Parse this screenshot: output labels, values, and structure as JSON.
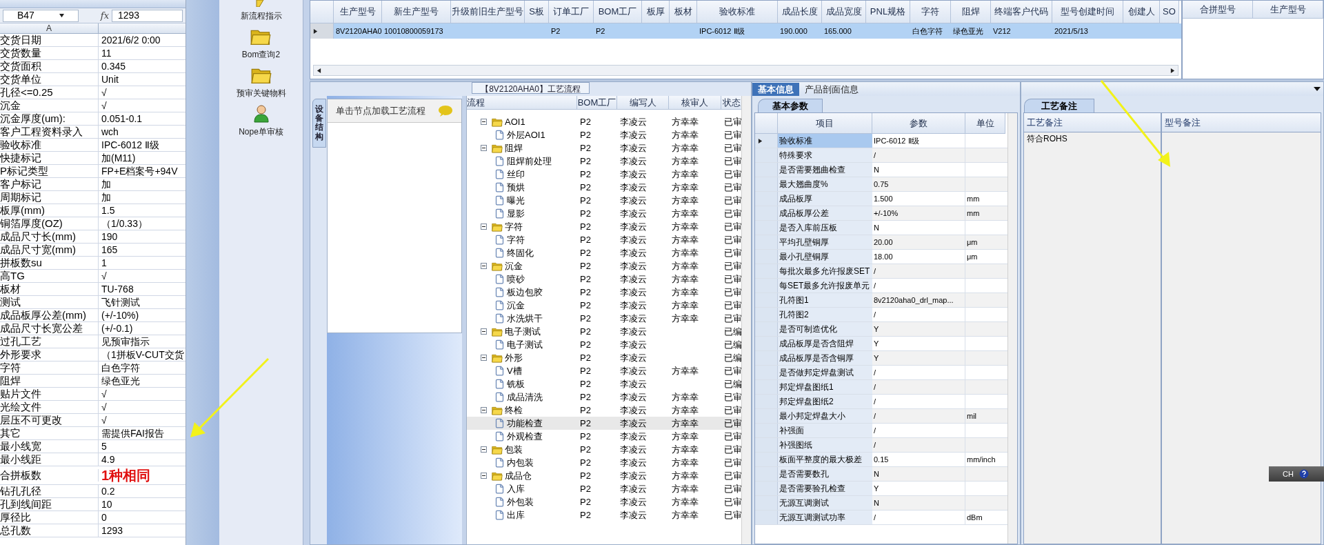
{
  "spreadsheet": {
    "name_box": "B47",
    "formula_label": "fx",
    "formula": "1293",
    "column_header": "A",
    "rows": [
      {
        "label": "交货日期",
        "value": "2021/6/2 0:00",
        "kind": "text"
      },
      {
        "label": "交货数量",
        "value": "11",
        "kind": "text"
      },
      {
        "label": "交货面积",
        "value": "0.345",
        "kind": "text"
      },
      {
        "label": "交货单位",
        "value": "Unit",
        "kind": "text"
      },
      {
        "label": "孔径<=0.25",
        "value": "√",
        "kind": "text"
      },
      {
        "label": "沉金",
        "value": "√",
        "kind": "text"
      },
      {
        "label": "沉金厚度(um):",
        "value": "0.051-0.1",
        "kind": "text"
      },
      {
        "label": "客户工程资料录入",
        "value": "wch",
        "kind": "text"
      },
      {
        "label": "验收标准",
        "value": "IPC-6012 Ⅱ级",
        "kind": "text"
      },
      {
        "label": "快捷标记",
        "value": "加(M11)",
        "kind": "text"
      },
      {
        "label": "P标记类型",
        "value": "FP+E档案号+94V",
        "kind": "text"
      },
      {
        "label": "客户标记",
        "value": "加",
        "kind": "text"
      },
      {
        "label": "周期标记",
        "value": "加",
        "kind": "text"
      },
      {
        "label": "板厚(mm)",
        "value": "1.5",
        "kind": "text"
      },
      {
        "label": "铜箔厚度(OZ)",
        "value": "（1/0.33）",
        "kind": "text"
      },
      {
        "label": "成品尺寸长(mm)",
        "value": "190",
        "kind": "text"
      },
      {
        "label": "成品尺寸宽(mm)",
        "value": "165",
        "kind": "text"
      },
      {
        "label": "拼板数su",
        "value": "1",
        "kind": "text"
      },
      {
        "label": "高TG",
        "value": "√",
        "kind": "text"
      },
      {
        "label": "板材",
        "value": "TU-768",
        "kind": "text"
      },
      {
        "label": "测试",
        "value": "飞针测试",
        "kind": "text"
      },
      {
        "label": "成品板厚公差(mm)",
        "value": "(+/-10%)",
        "kind": "text"
      },
      {
        "label": "成品尺寸长宽公差",
        "value": "(+/-0.1)",
        "kind": "text"
      },
      {
        "label": "过孔工艺",
        "value": "见预审指示",
        "kind": "text"
      },
      {
        "label": "外形要求",
        "value": "（1拼板V-CUT交货",
        "kind": "text"
      },
      {
        "label": "字符",
        "value": "白色字符",
        "kind": "text"
      },
      {
        "label": "阻焊",
        "value": "绿色亚光",
        "kind": "text"
      },
      {
        "label": "贴片文件",
        "value": "√",
        "kind": "text"
      },
      {
        "label": "光绘文件",
        "value": "√",
        "kind": "text"
      },
      {
        "label": "层压不可更改",
        "value": "√",
        "kind": "text"
      },
      {
        "label": "其它",
        "value": "需提供FAI报告",
        "kind": "text"
      },
      {
        "label": "最小线宽",
        "value": "5",
        "kind": "text"
      },
      {
        "label": "最小线距",
        "value": "4.9",
        "kind": "text"
      },
      {
        "label": "合拼板数",
        "value": "1种相同",
        "kind": "emphasis"
      },
      {
        "label": "钻孔孔径",
        "value": "0.2",
        "kind": "text"
      },
      {
        "label": "孔到线间距",
        "value": "10",
        "kind": "text"
      },
      {
        "label": "厚径比",
        "value": "0",
        "kind": "text"
      },
      {
        "label": "总孔数",
        "value": "1293",
        "kind": "text"
      }
    ]
  },
  "sidebar": {
    "items": [
      {
        "label": "新流程指示",
        "kind": "pencil"
      },
      {
        "label": "Bom查询2",
        "kind": "folder"
      },
      {
        "label": "预审关键物料",
        "kind": "folder"
      },
      {
        "label": "Nope单审核",
        "kind": "person"
      }
    ]
  },
  "product_grid": {
    "columns": [
      "生产型号",
      "新生产型号",
      "升级前旧生产型号",
      "S板",
      "订单工厂",
      "BOM工厂",
      "板厚",
      "板材",
      "验收标准",
      "成品长度",
      "成品宽度",
      "PNL规格",
      "字符",
      "阻焊",
      "终端客户代码",
      "型号创建时间",
      "创建人",
      "SO"
    ],
    "rows": [
      {
        "selected": true,
        "cells": [
          "8V2120AHA0",
          "10010800059173",
          "",
          "",
          "P2",
          "P2",
          "",
          "",
          "IPC-6012 Ⅱ级",
          "190.000",
          "165.000",
          "",
          "白色字符",
          "绿色亚光",
          "V212",
          "2021/5/13",
          "",
          ""
        ]
      }
    ]
  },
  "merge_grid": {
    "columns": [
      "合拼型号",
      "生产型号"
    ]
  },
  "process_panel": {
    "title": "【8V2120AHA0】工艺流程",
    "side_tab": "设备结构",
    "hint": "单击节点加载工艺流程",
    "columns": [
      "流程",
      "BOM工厂",
      "编写人",
      "核审人",
      "状态"
    ],
    "rows": [
      {
        "name": "AOI1",
        "bom": "P2",
        "writer": "李凌云",
        "reviewer": "方幸幸",
        "status": "已审",
        "expanded": true,
        "selected": false,
        "children": [
          {
            "name": "外层AOI1",
            "bom": "P2",
            "writer": "李凌云",
            "reviewer": "方幸幸",
            "status": "已审",
            "selected": false
          }
        ]
      },
      {
        "name": "阻焊",
        "bom": "P2",
        "writer": "李凌云",
        "reviewer": "方幸幸",
        "status": "已审",
        "expanded": true,
        "selected": false,
        "children": [
          {
            "name": "阻焊前处理",
            "bom": "P2",
            "writer": "李凌云",
            "reviewer": "方幸幸",
            "status": "已审",
            "selected": false
          },
          {
            "name": "丝印",
            "bom": "P2",
            "writer": "李凌云",
            "reviewer": "方幸幸",
            "status": "已审",
            "selected": false
          },
          {
            "name": "预烘",
            "bom": "P2",
            "writer": "李凌云",
            "reviewer": "方幸幸",
            "status": "已审",
            "selected": false
          },
          {
            "name": "曝光",
            "bom": "P2",
            "writer": "李凌云",
            "reviewer": "方幸幸",
            "status": "已审",
            "selected": false
          },
          {
            "name": "显影",
            "bom": "P2",
            "writer": "李凌云",
            "reviewer": "方幸幸",
            "status": "已审",
            "selected": false
          }
        ]
      },
      {
        "name": "字符",
        "bom": "P2",
        "writer": "李凌云",
        "reviewer": "方幸幸",
        "status": "已审",
        "expanded": true,
        "selected": false,
        "children": [
          {
            "name": "字符",
            "bom": "P2",
            "writer": "李凌云",
            "reviewer": "方幸幸",
            "status": "已审",
            "selected": false
          },
          {
            "name": "终固化",
            "bom": "P2",
            "writer": "李凌云",
            "reviewer": "方幸幸",
            "status": "已审",
            "selected": false
          }
        ]
      },
      {
        "name": "沉金",
        "bom": "P2",
        "writer": "李凌云",
        "reviewer": "方幸幸",
        "status": "已审",
        "expanded": true,
        "selected": false,
        "children": [
          {
            "name": "喷砂",
            "bom": "P2",
            "writer": "李凌云",
            "reviewer": "方幸幸",
            "status": "已审",
            "selected": false
          },
          {
            "name": "板边包胶",
            "bom": "P2",
            "writer": "李凌云",
            "reviewer": "方幸幸",
            "status": "已审",
            "selected": false
          },
          {
            "name": "沉金",
            "bom": "P2",
            "writer": "李凌云",
            "reviewer": "方幸幸",
            "status": "已审",
            "selected": false
          },
          {
            "name": "水洗烘干",
            "bom": "P2",
            "writer": "李凌云",
            "reviewer": "方幸幸",
            "status": "已审",
            "selected": false
          }
        ]
      },
      {
        "name": "电子测试",
        "bom": "P2",
        "writer": "李凌云",
        "status": "已编",
        "expanded": true,
        "selected": false,
        "children": [
          {
            "name": "电子测试",
            "bom": "P2",
            "writer": "李凌云",
            "status": "已编",
            "selected": false
          }
        ]
      },
      {
        "name": "外形",
        "bom": "P2",
        "writer": "李凌云",
        "status": "已编",
        "expanded": true,
        "selected": false,
        "children": [
          {
            "name": "V槽",
            "bom": "P2",
            "writer": "李凌云",
            "reviewer": "方幸幸",
            "status": "已审",
            "selected": false
          },
          {
            "name": "铣板",
            "bom": "P2",
            "writer": "李凌云",
            "status": "已编",
            "selected": false
          },
          {
            "name": "成品清洗",
            "bom": "P2",
            "writer": "李凌云",
            "reviewer": "方幸幸",
            "status": "已审",
            "selected": false
          }
        ]
      },
      {
        "name": "终检",
        "bom": "P2",
        "writer": "李凌云",
        "reviewer": "方幸幸",
        "status": "已审",
        "expanded": true,
        "selected": false,
        "children": [
          {
            "name": "功能检查",
            "bom": "P2",
            "writer": "李凌云",
            "reviewer": "方幸幸",
            "status": "已审",
            "selected": true
          },
          {
            "name": "外观检查",
            "bom": "P2",
            "writer": "李凌云",
            "reviewer": "方幸幸",
            "status": "已审",
            "selected": false
          }
        ]
      },
      {
        "name": "包装",
        "bom": "P2",
        "writer": "李凌云",
        "reviewer": "方幸幸",
        "status": "已审",
        "expanded": true,
        "selected": false,
        "children": [
          {
            "name": "内包装",
            "bom": "P2",
            "writer": "李凌云",
            "reviewer": "方幸幸",
            "status": "已审",
            "selected": false
          }
        ]
      },
      {
        "name": "成品仓",
        "bom": "P2",
        "writer": "李凌云",
        "reviewer": "方幸幸",
        "status": "已审",
        "expanded": true,
        "selected": false,
        "children": [
          {
            "name": "入库",
            "bom": "P2",
            "writer": "李凌云",
            "reviewer": "方幸幸",
            "status": "已审",
            "selected": false
          },
          {
            "name": "外包装",
            "bom": "P2",
            "writer": "李凌云",
            "reviewer": "方幸幸",
            "status": "已审",
            "selected": false
          },
          {
            "name": "出库",
            "bom": "P2",
            "writer": "李凌云",
            "reviewer": "方幸幸",
            "status": "已审",
            "selected": false
          }
        ]
      }
    ]
  },
  "info_panel": {
    "tabs": [
      {
        "label": "基本信息",
        "selected": true
      },
      {
        "label": "产品剖面信息",
        "selected": false
      }
    ],
    "subtab": "基本参数",
    "columns": [
      "项目",
      "参数",
      "单位"
    ],
    "rows": [
      {
        "item": "验收标准",
        "value": "IPC-6012 Ⅱ级",
        "unit": "",
        "selected": true
      },
      {
        "item": "特殊要求",
        "value": "/",
        "unit": "",
        "selected": false
      },
      {
        "item": "是否需要翘曲检查",
        "value": "N",
        "unit": "",
        "selected": false
      },
      {
        "item": "最大翘曲度%",
        "value": "0.75",
        "unit": "",
        "selected": false
      },
      {
        "item": "成品板厚",
        "value": "1.500",
        "unit": "mm",
        "selected": false
      },
      {
        "item": "成品板厚公差",
        "value": "+/-10%",
        "unit": "mm",
        "selected": false
      },
      {
        "item": "是否入库前压板",
        "value": "N",
        "unit": "",
        "selected": false
      },
      {
        "item": "平均孔壁铜厚",
        "value": "20.00",
        "unit": "μm",
        "selected": false
      },
      {
        "item": "最小孔壁铜厚",
        "value": "18.00",
        "unit": "μm",
        "selected": false
      },
      {
        "item": "每批次最多允许报废SET",
        "value": "/",
        "unit": "",
        "selected": false
      },
      {
        "item": "每SET最多允许报废单元",
        "value": "/",
        "unit": "",
        "selected": false
      },
      {
        "item": "孔符图1",
        "value": "8v2120aha0_drl_map...",
        "unit": "",
        "selected": false
      },
      {
        "item": "孔符图2",
        "value": "/",
        "unit": "",
        "selected": false
      },
      {
        "item": "是否可制造优化",
        "value": "Y",
        "unit": "",
        "selected": false
      },
      {
        "item": "成品板厚是否含阻焊",
        "value": "Y",
        "unit": "",
        "selected": false
      },
      {
        "item": "成品板厚是否含铜厚",
        "value": "Y",
        "unit": "",
        "selected": false
      },
      {
        "item": "是否做邦定焊盘测试",
        "value": "/",
        "unit": "",
        "selected": false
      },
      {
        "item": "邦定焊盘图纸1",
        "value": "/",
        "unit": "",
        "selected": false
      },
      {
        "item": "邦定焊盘图纸2",
        "value": "/",
        "unit": "",
        "selected": false
      },
      {
        "item": "最小邦定焊盘大小",
        "value": "/",
        "unit": "mil",
        "selected": false
      },
      {
        "item": "补强面",
        "value": "/",
        "unit": "",
        "selected": false
      },
      {
        "item": "补强图纸",
        "value": "/",
        "unit": "",
        "selected": false
      },
      {
        "item": "板面平整度的最大极差",
        "value": "0.15",
        "unit": "mm/inch",
        "selected": false
      },
      {
        "item": "是否需要数孔",
        "value": "N",
        "unit": "",
        "selected": false
      },
      {
        "item": "是否需要验孔检查",
        "value": "Y",
        "unit": "",
        "selected": false
      },
      {
        "item": "无源互调测试",
        "value": "N",
        "unit": "",
        "selected": false
      },
      {
        "item": "无源互调测试功率",
        "value": "/",
        "unit": "dBm",
        "selected": false
      }
    ]
  },
  "remarks_panel": {
    "subtab": "工艺备注",
    "columns": [
      "工艺备注",
      "型号备注"
    ],
    "process_note": "符合ROHS"
  },
  "ime_bar": {
    "label": "CH"
  }
}
